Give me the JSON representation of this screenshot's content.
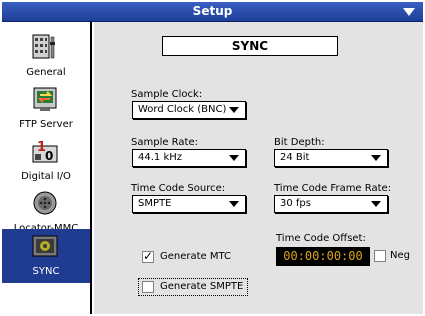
{
  "window": {
    "title": "Setup"
  },
  "sidebar": {
    "items": [
      {
        "label": "General",
        "icon": "general-icon"
      },
      {
        "label": "FTP Server",
        "icon": "ftp-server-icon"
      },
      {
        "label": "Digital I/O",
        "icon": "digital-io-icon"
      },
      {
        "label": "Locator-MMC",
        "icon": "locator-mmc-icon"
      },
      {
        "label": "SYNC",
        "icon": "sync-icon",
        "selected": true
      }
    ]
  },
  "panel": {
    "heading": "SYNC",
    "sample_clock": {
      "label": "Sample Clock:",
      "value": "Word Clock (BNC)"
    },
    "sample_rate": {
      "label": "Sample Rate:",
      "value": "44.1 kHz"
    },
    "bit_depth": {
      "label": "Bit Depth:",
      "value": "24 Bit"
    },
    "time_code_source": {
      "label": "Time Code Source:",
      "value": "SMPTE"
    },
    "time_code_frame_rate": {
      "label": "Time Code Frame Rate:",
      "value": "30 fps"
    },
    "time_code_offset": {
      "label": "Time Code Offset:",
      "value": "00:00:00:00"
    },
    "neg": {
      "label": "Neg",
      "checked": false
    },
    "generate_mtc": {
      "label": "Generate MTC",
      "checked": true,
      "mark": "✓"
    },
    "generate_smpte": {
      "label": "Generate SMPTE",
      "checked": false
    }
  },
  "colors": {
    "titlebar": "#2a4fb0",
    "selected_item": "#1f3c91",
    "panel_bg": "#e3e3e3",
    "timecode_digits": "#d9a21a"
  }
}
